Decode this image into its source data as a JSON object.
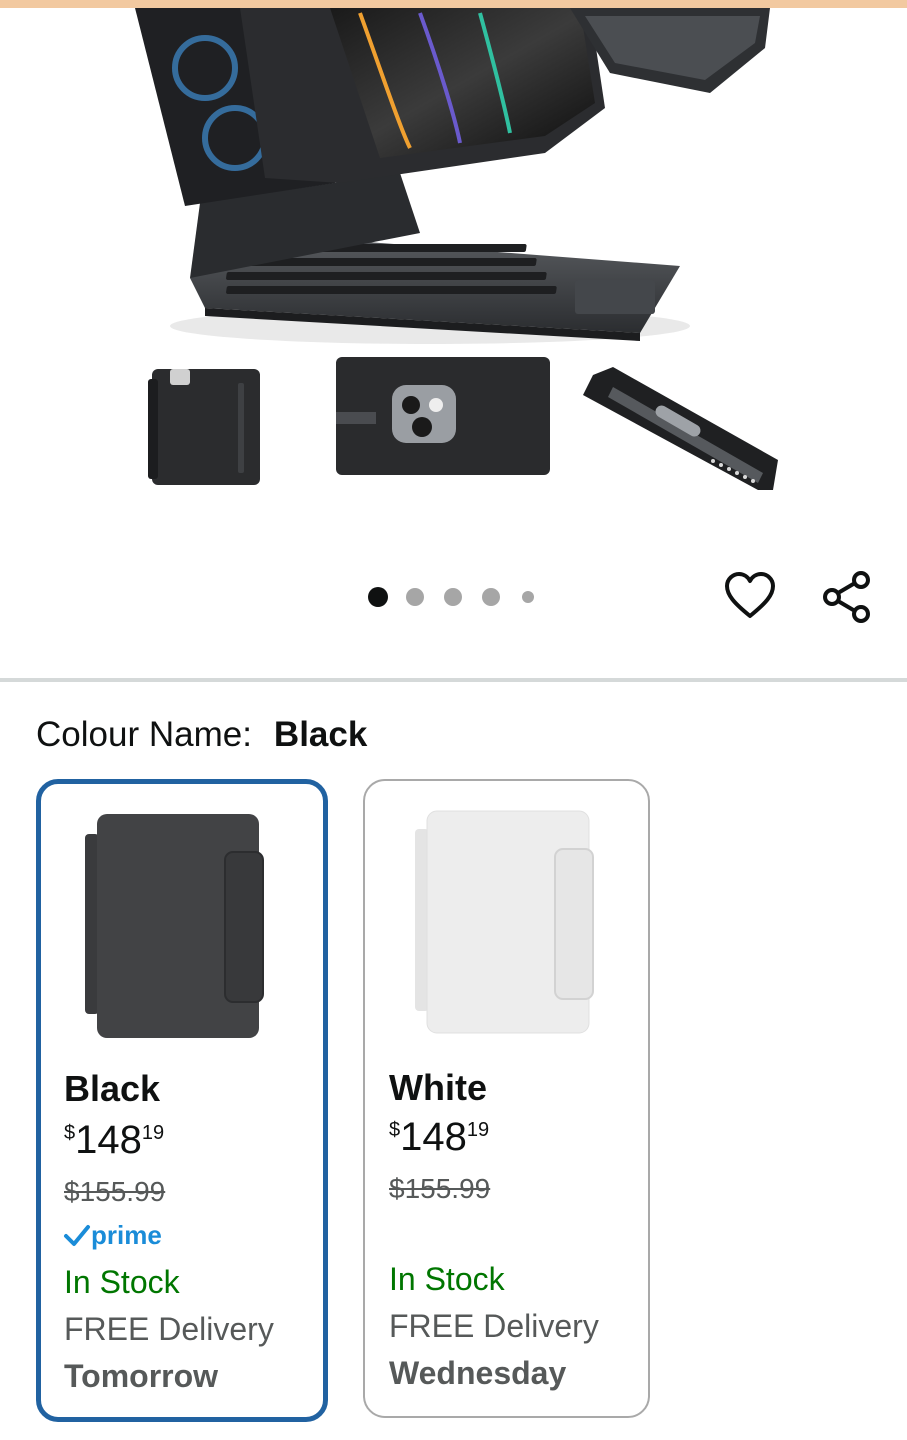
{
  "product": {
    "hero_image": "ipad-keyboard-case-hero",
    "thumbnails": [
      "case-back-thumbnail",
      "camera-cutout-thumbnail",
      "case-edge-thumbnail"
    ],
    "carousel": {
      "count": 5,
      "active_index": 0
    },
    "actions": {
      "wishlist_icon": "heart-icon",
      "share_icon": "share-icon"
    }
  },
  "colour": {
    "label": "Colour Name:",
    "selected": "Black"
  },
  "options": [
    {
      "name": "Black",
      "price_symbol": "$",
      "price_whole": "148",
      "price_fraction": "19",
      "list_price": "$155.99",
      "prime": "prime",
      "stock": "In Stock",
      "delivery": "FREE Delivery",
      "delivery_day": "Tomorrow",
      "selected": true
    },
    {
      "name": "White",
      "price_symbol": "$",
      "price_whole": "148",
      "price_fraction": "19",
      "list_price": "$155.99",
      "stock": "In Stock",
      "delivery": "FREE Delivery",
      "delivery_day": "Wednesday",
      "selected": false
    }
  ],
  "colors": {
    "selected_border": "#2162a1",
    "in_stock": "#007600",
    "prime": "#1a8cd8",
    "muted_text": "#565959"
  }
}
